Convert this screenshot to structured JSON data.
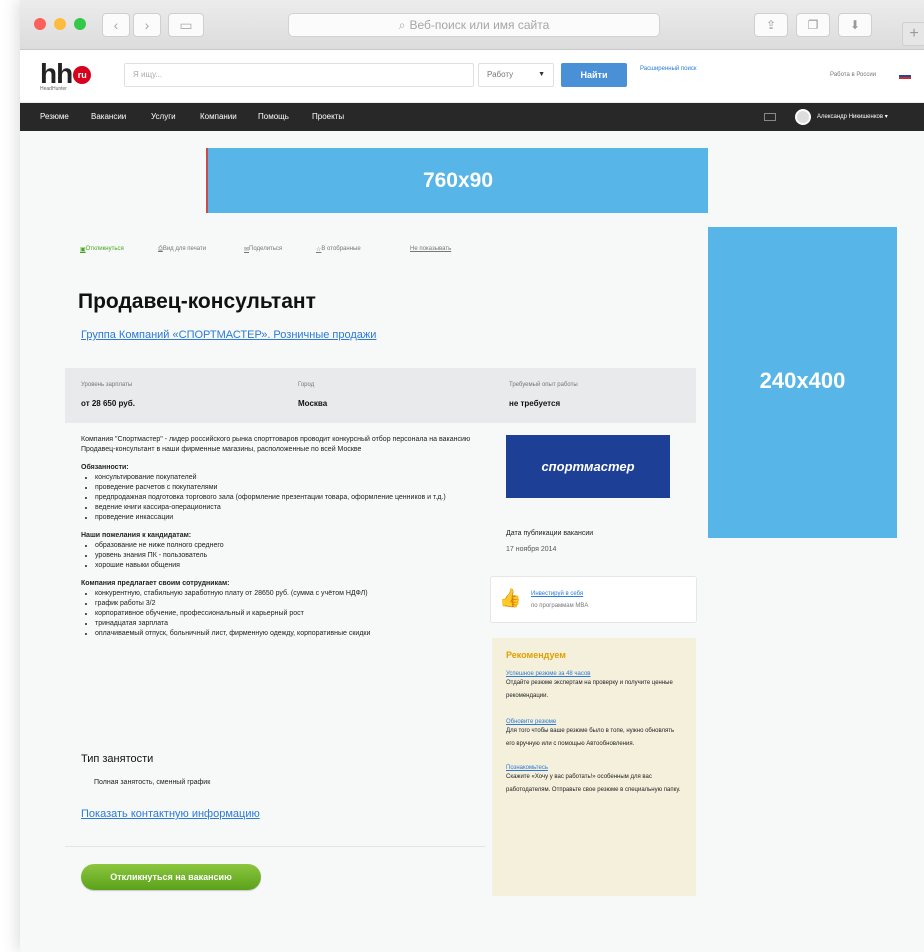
{
  "browser": {
    "url_placeholder": "Веб-поиск или имя сайта",
    "plus_label": "+"
  },
  "header": {
    "logo_text": "hh",
    "logo_badge": "ru",
    "logo_sub": "HeadHunter",
    "search_placeholder": "Я ищу...",
    "search_scope": "Работу",
    "find_button": "Найти",
    "advanced_search": "Расширенный поиск",
    "region_link": "Работа в России"
  },
  "menu": {
    "items": [
      "Резюме",
      "Вакансии",
      "Услуги",
      "Компании",
      "Помощь",
      "Проекты"
    ],
    "user_name": "Александр Никишенков"
  },
  "banners": {
    "top": "760x90",
    "side": "240x400"
  },
  "actions": {
    "respond": "Откликнуться",
    "print": "Вид для печати",
    "share": "Поделиться",
    "favorite": "В отобранные",
    "hide": "Не показывать"
  },
  "vacancy": {
    "title": "Продавец-консультант",
    "company": "Группа Компаний «СПОРТМАСТЕР». Розничные продажи",
    "salary_label": "Уровень зарплаты",
    "salary_value": "от 28 650 руб.",
    "city_label": "Город",
    "city_value": "Москва",
    "experience_label": "Требуемый опыт работы",
    "experience_value": "не требуется",
    "intro": "Компания \"Спортмастер\" - лидер российского рынка спорттоваров проводит конкурсный отбор персонала на вакансию Продавец-консультант в наши фирменные магазины, расположенные по всей Москве",
    "duties_title": "Обязанности:",
    "duties": [
      "консультирование покупателей",
      "проведение расчетов с покупателями",
      "предпродажная подготовка торгового зала (оформление презентации товара, оформление ценников и т.д.)",
      "ведение книги кассира-операциониста",
      "проведение инкассации"
    ],
    "wishes_title": "Наши пожелания к кандидатам:",
    "wishes": [
      "образование не ниже полного среднего",
      "уровень знания ПК - пользователь",
      "хорошие навыки общения"
    ],
    "offers_title": "Компания предлагает своим сотрудникам:",
    "offers": [
      "конкурентную, стабильную заработную плату от 28650 руб. (сумма с учётом НДФЛ)",
      "график работы 3/2",
      "корпоративное обучение, профессиональный и карьерный рост",
      "тринадцатая зарплата",
      "оплачиваемый отпуск, больничный лист, фирменную одежду, корпоративные скидки"
    ],
    "employment_title": "Тип занятости",
    "employment_value": "Полная занятость, сменный график",
    "show_contacts": "Показать контактную информацию",
    "respond_button": "Откликнуться на вакансию"
  },
  "sidebar": {
    "company_logo": "спортмастер",
    "pub_label": "Дата публикации вакансии",
    "pub_date": "17 ноября 2014",
    "mba_link": "Инвестируй в себя",
    "mba_sub": "по программам MBA",
    "recs_title": "Рекомендуем",
    "recs": [
      {
        "link": "Успешное резюме за 48 часов",
        "text": "Отдайте резюме экспертам на проверку и получите ценные рекомендации."
      },
      {
        "link": "Обновите резюме",
        "text": "Для того чтобы ваше резюме было в топе, нужно обновлять его вручную или с помощью Автообновления."
      },
      {
        "link": "Познакомьтесь",
        "text": "Скажите «Хочу у вас работать!» особенным для вас работодателям. Отправьте свое резюме в специальную папку."
      }
    ]
  },
  "colors": {
    "accent_blue": "#2b7ad8",
    "banner_blue": "#57b5e7",
    "menu_dark": "#282828",
    "respond_green": "#5aa21a",
    "brand_red": "#d6001c"
  }
}
